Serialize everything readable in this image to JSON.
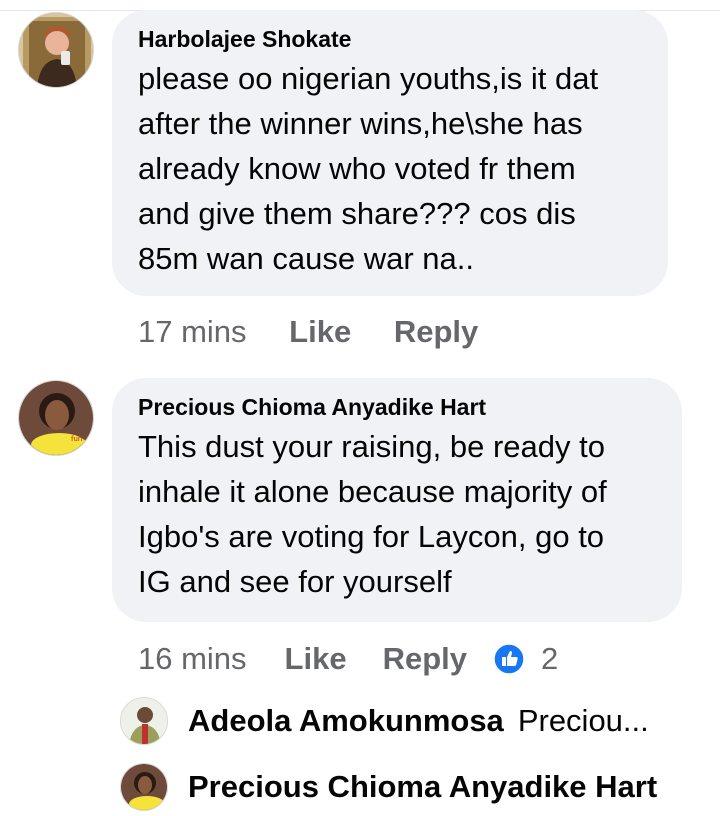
{
  "comments": [
    {
      "author": "Harbolajee Shokate",
      "text_lines": [
        "please oo nigerian youths,is it dat",
        "after the winner wins,he\\she has",
        "already know who voted fr them",
        "and give them share??? cos dis",
        "85m wan cause war na.."
      ],
      "time": "17 mins",
      "like_label": "Like",
      "reply_label": "Reply"
    },
    {
      "author": "Precious Chioma Anyadike Hart",
      "text_lines": [
        "This dust your raising, be ready to",
        "inhale it alone because majority of",
        "Igbo's are voting for Laycon, go to",
        "IG and see for yourself"
      ],
      "time": "16 mins",
      "like_label": "Like",
      "reply_label": "Reply",
      "reaction_count": "2",
      "reaction_icon": "thumbs-up-icon",
      "reaction_color": "#1877f2"
    }
  ],
  "replies": [
    {
      "author": "Adeola Amokunmosa",
      "snippet": "Preciou..."
    },
    {
      "author": "Precious Chioma Anyadike Hart",
      "snippet": ""
    }
  ],
  "colors": {
    "bubble": "#f0f2f5",
    "meta": "#65676b",
    "text": "#050505",
    "accent": "#1877f2"
  }
}
